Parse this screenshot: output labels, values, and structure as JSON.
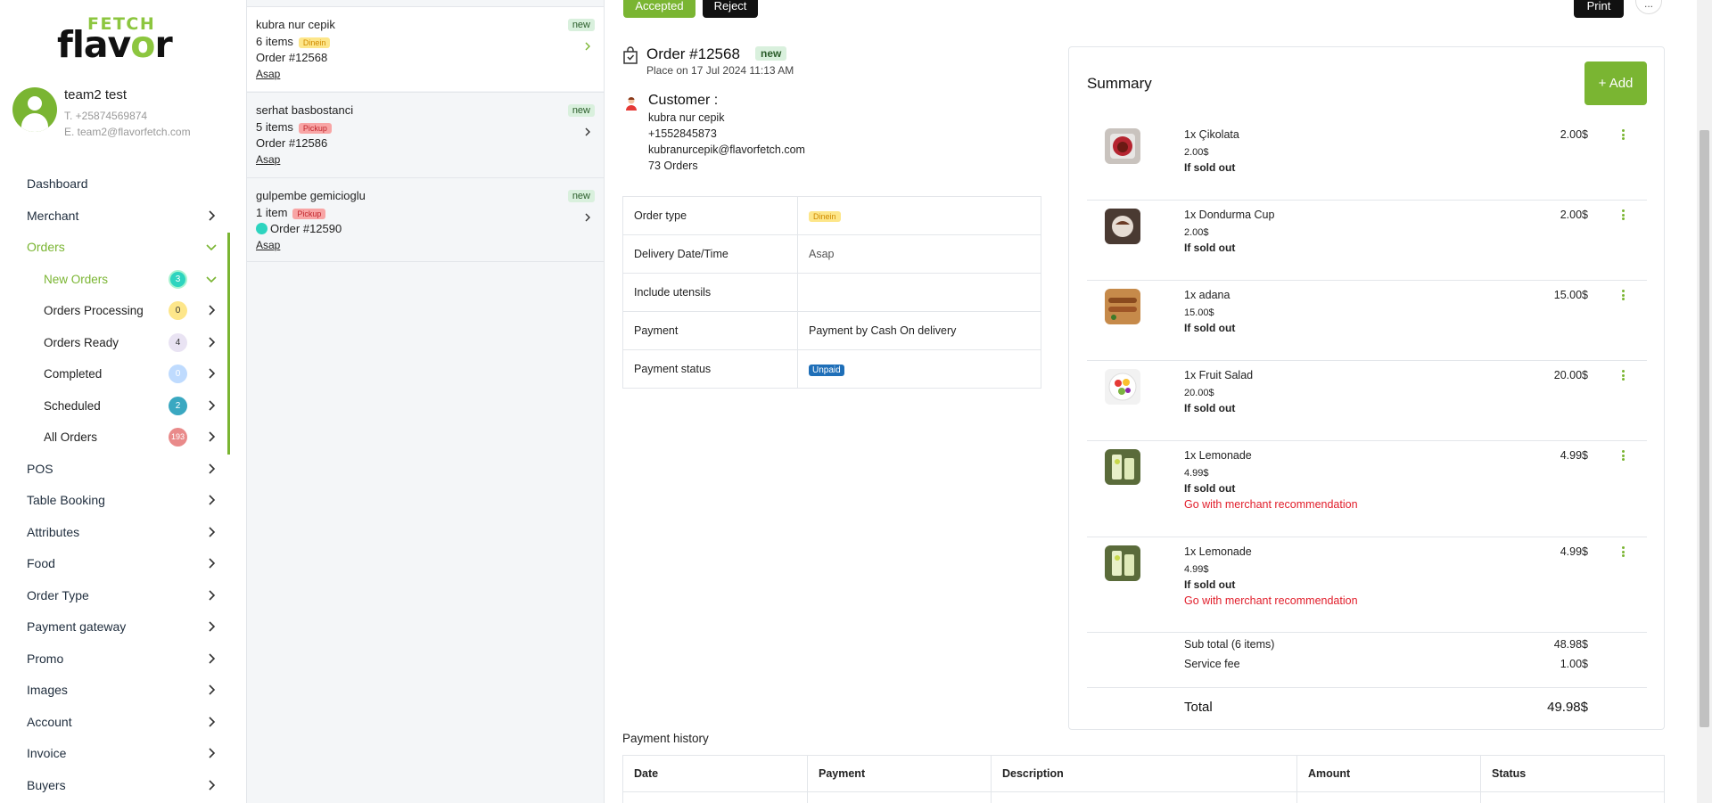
{
  "brand": {
    "fetch": "FETCH",
    "flavor_pre": "flav",
    "flavor_o": "o",
    "flavor_post": "r"
  },
  "user": {
    "name": "team2 test",
    "phone": "T. +25874569874",
    "email": "E. team2@flavorfetch.com"
  },
  "sidebar": {
    "items": [
      {
        "label": "Dashboard"
      },
      {
        "label": "Merchant"
      },
      {
        "label": "Orders"
      },
      {
        "label": "New Orders",
        "count": "3"
      },
      {
        "label": "Orders Processing",
        "count": "0"
      },
      {
        "label": "Orders Ready",
        "count": "4"
      },
      {
        "label": "Completed",
        "count": "0"
      },
      {
        "label": "Scheduled",
        "count": "2"
      },
      {
        "label": "All Orders",
        "count": "193"
      },
      {
        "label": "POS"
      },
      {
        "label": "Table Booking"
      },
      {
        "label": "Attributes"
      },
      {
        "label": "Food"
      },
      {
        "label": "Order Type"
      },
      {
        "label": "Payment gateway"
      },
      {
        "label": "Promo"
      },
      {
        "label": "Images"
      },
      {
        "label": "Account"
      },
      {
        "label": "Invoice"
      },
      {
        "label": "Buyers"
      }
    ],
    "accent": "#7ab532"
  },
  "orders": [
    {
      "customer": "kubra nur cepik",
      "items": "6 items",
      "type": "Dinein",
      "number": "Order #12568",
      "when": "Asap",
      "status": "new"
    },
    {
      "customer": "serhat basbostanci",
      "items": "5 items",
      "type": "Pickup",
      "number": "Order #12586",
      "when": "Asap",
      "status": "new"
    },
    {
      "customer": "gulpembe gemicioglu",
      "items": "1 item",
      "type": "Pickup",
      "number": "Order #12590",
      "when": "Asap",
      "status": "new"
    }
  ],
  "actions": {
    "accepted": "Accepted",
    "reject": "Reject",
    "print": "Print",
    "more": "..."
  },
  "order": {
    "title": "Order #12568",
    "status": "new",
    "placed": "Place on 17 Jul 2024 11:13 AM",
    "customer_label": "Customer :",
    "customer_name": "kubra nur cepik",
    "customer_phone": "+1552845873",
    "customer_email": "kubranurcepik@flavorfetch.com",
    "customer_orders": "73 Orders"
  },
  "info": {
    "order_type_label": "Order type",
    "order_type": "Dinein",
    "delivery_label": "Delivery Date/Time",
    "delivery": "Asap",
    "utensils_label": "Include utensils",
    "utensils": "",
    "payment_label": "Payment",
    "payment": "Payment by Cash On delivery",
    "payment_status_label": "Payment status",
    "payment_status": "Unpaid"
  },
  "summary": {
    "title": "Summary",
    "add": "+ Add",
    "items": [
      {
        "name": "1x Çikolata",
        "price": "2.00$",
        "amount": "2.00$",
        "sold": "If sold out",
        "rec": ""
      },
      {
        "name": "1x Dondurma Cup",
        "price": "2.00$",
        "amount": "2.00$",
        "sold": "If sold out",
        "rec": ""
      },
      {
        "name": "1x adana",
        "price": "15.00$",
        "amount": "15.00$",
        "sold": "If sold out",
        "rec": ""
      },
      {
        "name": "1x Fruit Salad",
        "price": "20.00$",
        "amount": "20.00$",
        "sold": "If sold out",
        "rec": ""
      },
      {
        "name": "1x Lemonade",
        "price": "4.99$",
        "amount": "4.99$",
        "sold": "If sold out",
        "rec": "Go with merchant recommendation"
      },
      {
        "name": "1x Lemonade",
        "price": "4.99$",
        "amount": "4.99$",
        "sold": "If sold out",
        "rec": "Go with merchant recommendation"
      }
    ],
    "subtotal_label": "Sub total (6 items)",
    "subtotal": "48.98$",
    "fee_label": "Service fee",
    "fee": "1.00$",
    "total_label": "Total",
    "total": "49.98$"
  },
  "payment_history": {
    "title": "Payment history",
    "columns": [
      "Date",
      "Payment",
      "Description",
      "Amount",
      "Status"
    ]
  }
}
